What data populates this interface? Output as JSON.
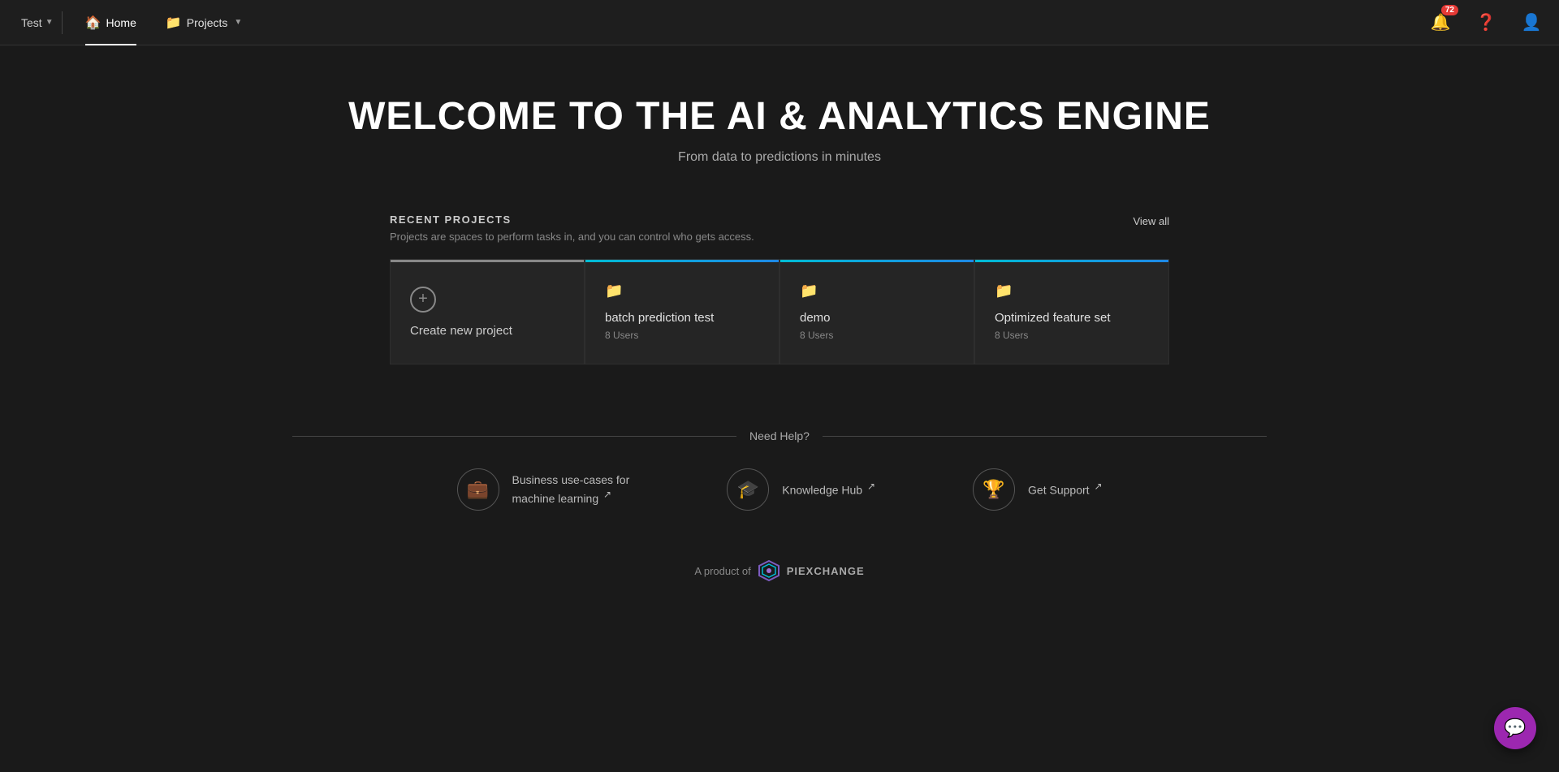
{
  "nav": {
    "workspace_label": "Test",
    "home_label": "Home",
    "projects_label": "Projects",
    "notification_count": "72",
    "home_icon": "🏠",
    "projects_icon": "📁"
  },
  "hero": {
    "title": "WELCOME TO THE AI & ANALYTICS ENGINE",
    "subtitle": "From data to predictions in minutes"
  },
  "recent_projects": {
    "section_title": "RECENT PROJECTS",
    "section_desc": "Projects are spaces to perform tasks in, and you can control who gets access.",
    "view_all_label": "View all",
    "create_label": "Create new project",
    "projects": [
      {
        "name": "batch prediction test",
        "users": "8 Users"
      },
      {
        "name": "demo",
        "users": "8 Users"
      },
      {
        "name": "Optimized feature set",
        "users": "8 Users"
      }
    ]
  },
  "help": {
    "heading": "Need Help?",
    "items": [
      {
        "icon": "💼",
        "label": "Business use-cases for\nmachine learning ↗",
        "label_line1": "Business use-cases for",
        "label_line2": "machine learning"
      },
      {
        "icon": "🎓",
        "label": "Knowledge Hub ↗",
        "label_line1": "Knowledge Hub"
      },
      {
        "icon": "🏆",
        "label": "Get Support ↗",
        "label_line1": "Get Support"
      }
    ]
  },
  "footer": {
    "label": "A product of",
    "brand": "PIEXCHANGE"
  }
}
